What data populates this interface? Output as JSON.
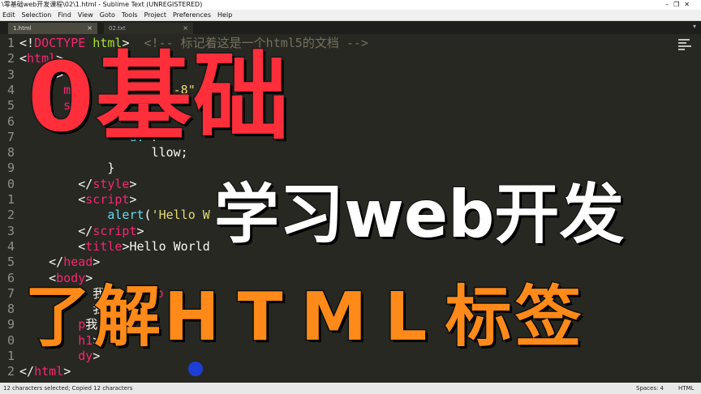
{
  "window": {
    "title": "\\零基础web开发课程\\02\\1.html - Sublime Text (UNREGISTERED)",
    "controls": [
      "–",
      "❐",
      "✕"
    ]
  },
  "menu": [
    "Edit",
    "Selection",
    "Find",
    "View",
    "Goto",
    "Tools",
    "Project",
    "Preferences",
    "Help"
  ],
  "tabs": [
    {
      "label": "1.html",
      "close": "×",
      "active": true
    },
    {
      "label": "02.txt",
      "close": "×",
      "active": false
    }
  ],
  "tab_dropdown": "▾",
  "gutter": [
    "1",
    "2",
    "3",
    "4",
    "5",
    "6",
    "7",
    "8",
    "9",
    "0",
    "1",
    "2",
    "3",
    "4",
    "5",
    "6",
    "7",
    "8",
    "9",
    "0",
    "1",
    "2"
  ],
  "code": {
    "l1": {
      "a": "<!",
      "b": "DOCTYPE",
      "c": " html",
      "d": ">",
      "e": "  <!-- 标记着这是一个html5的文档 -->"
    },
    "l2": {
      "a": "<",
      "b": "html",
      "c": ">"
    },
    "l3": {
      "a": "    ",
      "b": "d",
      "c": ">"
    },
    "l4": {
      "a": "      meta",
      "b": "",
      "c": "          f-8\""
    },
    "l5": {
      "a": "      sty"
    },
    "l7": {
      "a": "               d: ",
      "b": "r"
    },
    "l8": {
      "a": "                  llow;"
    },
    "l9": {
      "a": "            }"
    },
    "l10": {
      "a": "        </",
      "b": "style",
      "c": ">"
    },
    "l11": {
      "a": "        <",
      "b": "script",
      "c": ">"
    },
    "l12": {
      "a": "            ",
      "b": "alert",
      "c": "(",
      "d": "'Hello W"
    },
    "l13": {
      "a": "        </",
      "b": "script",
      "c": ">"
    },
    "l14": {
      "a": "        <",
      "b": "title",
      "c": ">",
      "d": "Hello World"
    },
    "l15": {
      "a": "    </",
      "b": "head",
      "c": ">"
    },
    "l16": {
      "a": "    <",
      "b": "body",
      "c": ">"
    },
    "l17": {
      "a": "          我",
      "b": "      /p"
    },
    "l18": {
      "a": "          我",
      "b": "   客</"
    },
    "l19": {
      "a": "        p",
      "b": "我",
      "c": "   客</"
    },
    "l20": {
      "a": "        h1",
      "b": ">"
    },
    "l21": {
      "a": "        dy",
      "b": ">"
    },
    "l22": {
      "a": "</",
      "b": "html",
      "c": ">"
    }
  },
  "overlay": {
    "line1": "0基础",
    "line2": "学习web开发",
    "line3_a": "了解",
    "line3_b": "HTML",
    "line3_c": "标签"
  },
  "status": {
    "left": "12 characters selected; Copied 12 characters",
    "spaces": "Spaces: 4",
    "syntax": "HTML"
  },
  "colors": {
    "background": "#272822",
    "tag": "#f92672",
    "attribute": "#a6e22e",
    "string": "#e6db74",
    "comment": "#75715e",
    "overlay_red": "#ff2e3b",
    "overlay_orange": "#ff8a19"
  }
}
